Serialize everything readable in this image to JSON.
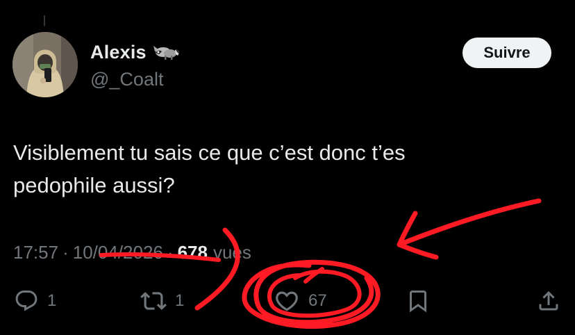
{
  "colors": {
    "background": "#000000",
    "primary_text": "#e7e9ea",
    "secondary_text": "#71767b",
    "follow_button_bg": "#eff3f4",
    "follow_button_text": "#0f1419",
    "annotation_red": "#ff1a24"
  },
  "author": {
    "display_name": "Alexis",
    "name_emoji": "raccoon-emoji",
    "handle": "@_Coalt",
    "avatar_icon": "profile-photo-avatar"
  },
  "follow_button": {
    "label": "Suivre"
  },
  "tweet": {
    "text": "Visiblement tu sais ce que c’est donc t’es\npedophile aussi?",
    "time": "17:57",
    "date": "10/04/2026",
    "separator": "·",
    "views_count": "678",
    "views_label": "vues"
  },
  "actions": {
    "reply": {
      "icon": "reply-icon",
      "count": "1"
    },
    "retweet": {
      "icon": "retweet-icon",
      "count": "1"
    },
    "like": {
      "icon": "heart-icon",
      "count": "67"
    },
    "bookmark": {
      "icon": "bookmark-icon"
    },
    "share": {
      "icon": "share-icon"
    }
  }
}
